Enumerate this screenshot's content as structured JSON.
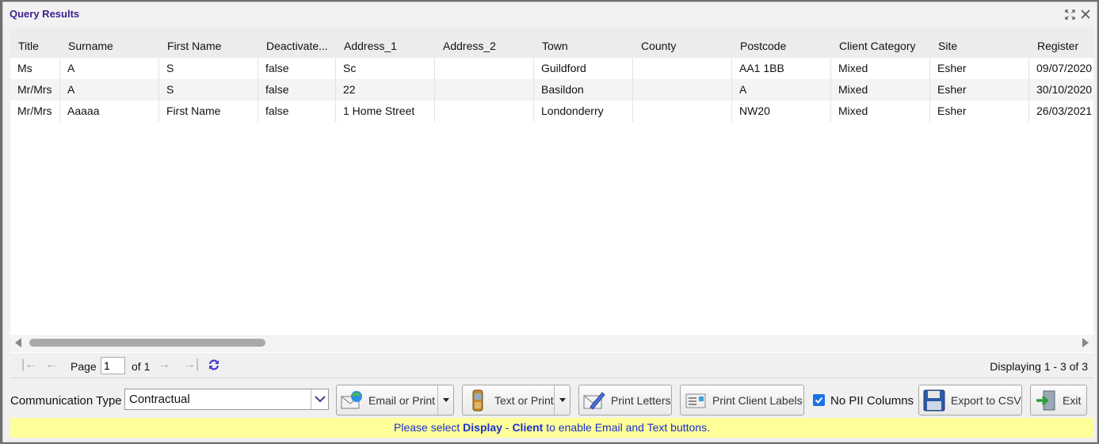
{
  "window": {
    "title": "Query Results"
  },
  "grid": {
    "columns": [
      "Title",
      "Surname",
      "First Name",
      "Deactivate...",
      "Address_1",
      "Address_2",
      "Town",
      "County",
      "Postcode",
      "Client Category",
      "Site",
      "Register"
    ],
    "rows": [
      [
        "Ms",
        "A",
        "S",
        "false",
        "Sc",
        "",
        "Guildford",
        "",
        "AA1 1BB",
        "Mixed",
        "Esher",
        "09/07/2020"
      ],
      [
        "Mr/Mrs",
        "A",
        "S",
        "false",
        "22",
        "",
        "Basildon",
        "",
        "A",
        "Mixed",
        "Esher",
        "30/10/2020"
      ],
      [
        "Mr/Mrs",
        "Aaaaa",
        "First Name",
        "false",
        "1 Home Street",
        "",
        "Londonderry",
        "",
        "NW20",
        "Mixed",
        "Esher",
        "26/03/2021"
      ]
    ]
  },
  "pager": {
    "page_label": "Page",
    "page_value": "1",
    "of_label": "of 1",
    "display_text": "Displaying 1 - 3 of 3"
  },
  "toolbar": {
    "comm_type_label": "Communication Type",
    "comm_type_value": "Contractual",
    "email_label": "Email or Print",
    "text_label": "Text or Print",
    "letters_label": "Print Letters",
    "labels_label": "Print Client Labels",
    "no_pii_label": "No PII Columns",
    "export_label": "Export to CSV",
    "exit_label": "Exit"
  },
  "notice": {
    "prefix": "Please select ",
    "bold1": "Display",
    "sep": " - ",
    "bold2": "Client",
    "suffix": " to enable Email and Text buttons."
  },
  "colors": {
    "title": "#3b1f8f",
    "notice_bg": "#ffff99",
    "notice_text": "#1a2fd1",
    "checkbox": "#1a73e8"
  }
}
